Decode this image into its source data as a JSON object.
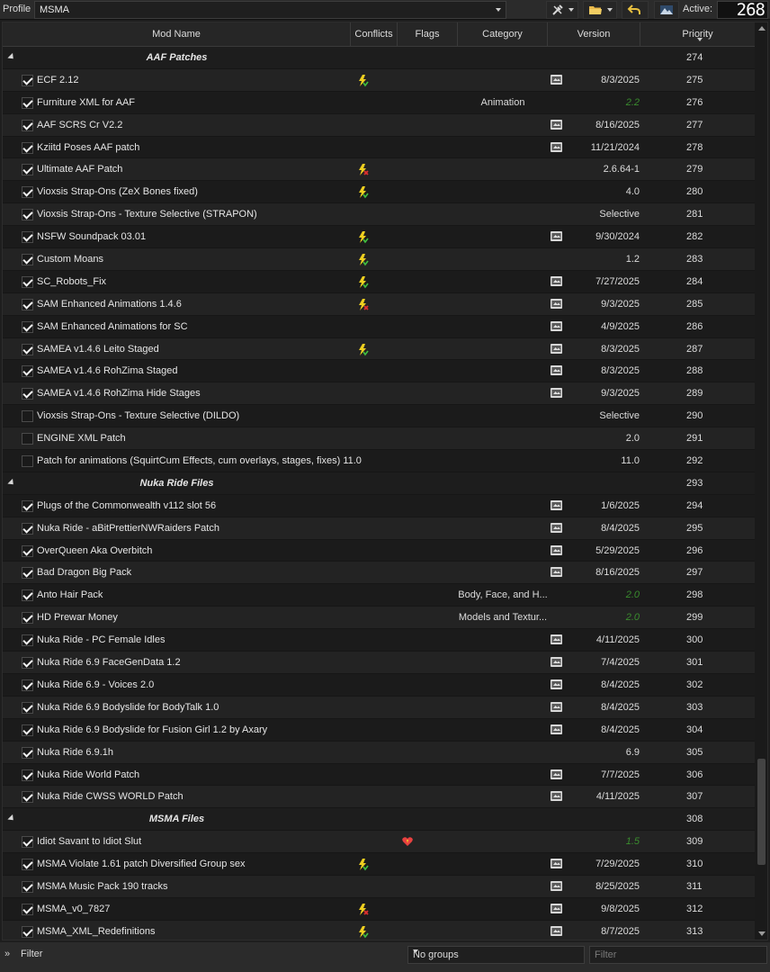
{
  "toolbar": {
    "profile_label": "Profile",
    "profile_value": "MSMA",
    "active_label": "Active:",
    "active_count": "268"
  },
  "columns": {
    "mod_name": "Mod Name",
    "conflicts": "Conflicts",
    "flags": "Flags",
    "category": "Category",
    "version": "Version",
    "priority": "Priority"
  },
  "colors": {
    "green_version": "#3a8c2e",
    "background": "#1e1e1e"
  },
  "rows": [
    {
      "type": "sep",
      "name": "AAF Patches",
      "priority": "274"
    },
    {
      "type": "mod",
      "checked": true,
      "name": "ECF 2.12",
      "conflict": "bolt",
      "flag": "backup",
      "category": "",
      "version": "8/3/2025",
      "green": false,
      "priority": "275"
    },
    {
      "type": "mod",
      "checked": true,
      "name": "Furniture XML for AAF",
      "conflict": "",
      "flag": "",
      "category": "Animation",
      "version": "2.2",
      "green": true,
      "priority": "276"
    },
    {
      "type": "mod",
      "checked": true,
      "name": "AAF SCRS Cr V2.2",
      "conflict": "",
      "flag": "backup",
      "category": "",
      "version": "8/16/2025",
      "green": false,
      "priority": "277"
    },
    {
      "type": "mod",
      "checked": true,
      "name": "Kziitd Poses AAF patch",
      "conflict": "",
      "flag": "backup",
      "category": "",
      "version": "11/21/2024",
      "green": false,
      "priority": "278"
    },
    {
      "type": "mod",
      "checked": true,
      "name": "Ultimate AAF Patch",
      "conflict": "bolt-red",
      "flag": "",
      "category": "",
      "version": "2.6.64-1",
      "green": false,
      "priority": "279"
    },
    {
      "type": "mod",
      "checked": true,
      "name": "Vioxsis Strap-Ons (ZeX Bones fixed)",
      "conflict": "bolt",
      "flag": "",
      "category": "",
      "version": "4.0",
      "green": false,
      "priority": "280"
    },
    {
      "type": "mod",
      "checked": true,
      "name": "Vioxsis Strap-Ons - Texture Selective (STRAPON)",
      "conflict": "",
      "flag": "",
      "category": "",
      "version": "Selective",
      "green": false,
      "priority": "281"
    },
    {
      "type": "mod",
      "checked": true,
      "name": "NSFW Soundpack 03.01",
      "conflict": "bolt",
      "flag": "backup",
      "category": "",
      "version": "9/30/2024",
      "green": false,
      "priority": "282"
    },
    {
      "type": "mod",
      "checked": true,
      "name": "Custom Moans",
      "conflict": "bolt",
      "flag": "",
      "category": "",
      "version": "1.2",
      "green": false,
      "priority": "283"
    },
    {
      "type": "mod",
      "checked": true,
      "name": "SC_Robots_Fix",
      "conflict": "bolt",
      "flag": "backup",
      "category": "",
      "version": "7/27/2025",
      "green": false,
      "priority": "284"
    },
    {
      "type": "mod",
      "checked": true,
      "name": "SAM Enhanced Animations 1.4.6",
      "conflict": "bolt-red",
      "flag": "backup",
      "category": "",
      "version": "9/3/2025",
      "green": false,
      "priority": "285"
    },
    {
      "type": "mod",
      "checked": true,
      "name": "SAM Enhanced Animations for SC",
      "conflict": "",
      "flag": "backup",
      "category": "",
      "version": "4/9/2025",
      "green": false,
      "priority": "286"
    },
    {
      "type": "mod",
      "checked": true,
      "name": "SAMEA v1.4.6 Leito Staged",
      "conflict": "bolt",
      "flag": "backup",
      "category": "",
      "version": "8/3/2025",
      "green": false,
      "priority": "287"
    },
    {
      "type": "mod",
      "checked": true,
      "name": "SAMEA v1.4.6 RohZima Staged",
      "conflict": "",
      "flag": "backup",
      "category": "",
      "version": "8/3/2025",
      "green": false,
      "priority": "288"
    },
    {
      "type": "mod",
      "checked": true,
      "name": "SAMEA v1.4.6 RohZima Hide Stages",
      "conflict": "",
      "flag": "backup",
      "category": "",
      "version": "9/3/2025",
      "green": false,
      "priority": "289"
    },
    {
      "type": "mod",
      "checked": false,
      "name": "Vioxsis Strap-Ons - Texture Selective (DILDO)",
      "conflict": "",
      "flag": "",
      "category": "",
      "version": "Selective",
      "green": false,
      "priority": "290"
    },
    {
      "type": "mod",
      "checked": false,
      "name": "ENGINE XML Patch",
      "conflict": "",
      "flag": "",
      "category": "",
      "version": "2.0",
      "green": false,
      "priority": "291"
    },
    {
      "type": "mod",
      "checked": false,
      "name": "Patch for animations (SquirtCum Effects, cum overlays, stages, fixes) 11.0",
      "conflict": "",
      "flag": "",
      "category": "",
      "version": "11.0",
      "green": false,
      "priority": "292"
    },
    {
      "type": "sep",
      "name": "Nuka Ride Files",
      "priority": "293"
    },
    {
      "type": "mod",
      "checked": true,
      "name": "Plugs of the Commonwealth v112 slot 56",
      "conflict": "",
      "flag": "backup",
      "category": "",
      "version": "1/6/2025",
      "green": false,
      "priority": "294"
    },
    {
      "type": "mod",
      "checked": true,
      "name": "Nuka Ride - aBitPrettierNWRaiders Patch",
      "conflict": "",
      "flag": "backup",
      "category": "",
      "version": "8/4/2025",
      "green": false,
      "priority": "295"
    },
    {
      "type": "mod",
      "checked": true,
      "name": "OverQueen Aka Overbitch",
      "conflict": "",
      "flag": "backup",
      "category": "",
      "version": "5/29/2025",
      "green": false,
      "priority": "296"
    },
    {
      "type": "mod",
      "checked": true,
      "name": "Bad Dragon Big Pack",
      "conflict": "",
      "flag": "backup",
      "category": "",
      "version": "8/16/2025",
      "green": false,
      "priority": "297"
    },
    {
      "type": "mod",
      "checked": true,
      "name": "Anto Hair Pack",
      "conflict": "",
      "flag": "",
      "category": "Body, Face, and H...",
      "version": "2.0",
      "green": true,
      "priority": "298"
    },
    {
      "type": "mod",
      "checked": true,
      "name": "HD Prewar Money",
      "conflict": "",
      "flag": "",
      "category": "Models and Textur...",
      "version": "2.0",
      "green": true,
      "priority": "299"
    },
    {
      "type": "mod",
      "checked": true,
      "name": "Nuka Ride - PC Female Idles",
      "conflict": "",
      "flag": "backup",
      "category": "",
      "version": "4/11/2025",
      "green": false,
      "priority": "300"
    },
    {
      "type": "mod",
      "checked": true,
      "name": "Nuka Ride 6.9 FaceGenData 1.2",
      "conflict": "",
      "flag": "backup",
      "category": "",
      "version": "7/4/2025",
      "green": false,
      "priority": "301"
    },
    {
      "type": "mod",
      "checked": true,
      "name": "Nuka Ride 6.9 - Voices 2.0",
      "conflict": "",
      "flag": "backup",
      "category": "",
      "version": "8/4/2025",
      "green": false,
      "priority": "302"
    },
    {
      "type": "mod",
      "checked": true,
      "name": "Nuka Ride 6.9 Bodyslide for BodyTalk 1.0",
      "conflict": "",
      "flag": "backup",
      "category": "",
      "version": "8/4/2025",
      "green": false,
      "priority": "303"
    },
    {
      "type": "mod",
      "checked": true,
      "name": "Nuka Ride 6.9 Bodyslide for Fusion Girl 1.2 by Axary",
      "conflict": "",
      "flag": "backup",
      "category": "",
      "version": "8/4/2025",
      "green": false,
      "priority": "304"
    },
    {
      "type": "mod",
      "checked": true,
      "name": "Nuka Ride 6.9.1h",
      "conflict": "",
      "flag": "",
      "category": "",
      "version": "6.9",
      "green": false,
      "priority": "305"
    },
    {
      "type": "mod",
      "checked": true,
      "name": "Nuka Ride World Patch",
      "conflict": "",
      "flag": "backup",
      "category": "",
      "version": "7/7/2025",
      "green": false,
      "priority": "306"
    },
    {
      "type": "mod",
      "checked": true,
      "name": "Nuka Ride CWSS WORLD Patch",
      "conflict": "",
      "flag": "backup",
      "category": "",
      "version": "4/11/2025",
      "green": false,
      "priority": "307"
    },
    {
      "type": "sep",
      "name": "MSMA Files",
      "priority": "308"
    },
    {
      "type": "mod",
      "checked": true,
      "name": "Idiot Savant to Idiot Slut",
      "conflict": "heart",
      "flag": "",
      "category": "",
      "version": "1.5",
      "green": true,
      "priority": "309"
    },
    {
      "type": "mod",
      "checked": true,
      "name": "MSMA Violate 1.61 patch Diversified Group sex",
      "conflict": "bolt",
      "flag": "backup",
      "category": "",
      "version": "7/29/2025",
      "green": false,
      "priority": "310"
    },
    {
      "type": "mod",
      "checked": true,
      "name": "MSMA Music Pack 190 tracks",
      "conflict": "",
      "flag": "backup",
      "category": "",
      "version": "8/25/2025",
      "green": false,
      "priority": "311"
    },
    {
      "type": "mod",
      "checked": true,
      "name": "MSMA_v0_7827",
      "conflict": "bolt-red",
      "flag": "backup",
      "category": "",
      "version": "9/8/2025",
      "green": false,
      "priority": "312"
    },
    {
      "type": "mod",
      "checked": true,
      "name": "MSMA_XML_Redefinitions",
      "conflict": "bolt",
      "flag": "backup",
      "category": "",
      "version": "8/7/2025",
      "green": false,
      "priority": "313"
    }
  ],
  "bottombar": {
    "filter_toggle": "»",
    "filter_label": "Filter",
    "groups_value": "No groups",
    "filter_placeholder": "Filter"
  }
}
